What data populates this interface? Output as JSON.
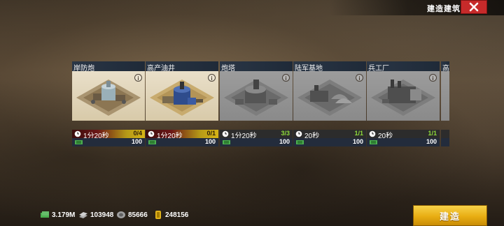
{
  "header": {
    "title": "建造建筑"
  },
  "buildings": [
    {
      "name": "岸防炮",
      "time": "1分20秒",
      "count": "0/4",
      "cost": "100",
      "state": "available"
    },
    {
      "name": "高产油井",
      "time": "1分20秒",
      "count": "0/1",
      "cost": "100",
      "state": "available"
    },
    {
      "name": "炮塔",
      "time": "1分20秒",
      "count": "3/3",
      "cost": "100",
      "state": "maxed"
    },
    {
      "name": "陆军基地",
      "time": "20秒",
      "count": "1/1",
      "cost": "100",
      "state": "maxed"
    },
    {
      "name": "兵工厂",
      "time": "20秒",
      "count": "1/1",
      "cost": "100",
      "state": "maxed"
    },
    {
      "name": "高",
      "time": "",
      "count": "",
      "cost": "",
      "state": "partial"
    }
  ],
  "resources": {
    "cash": "3.179M",
    "steel": "103948",
    "oil": "85666",
    "gold": "248156"
  },
  "actions": {
    "build_label": "建造"
  },
  "colors": {
    "build_button": "#e8ad12",
    "close_button": "#c72a2a",
    "header": "#1f2a38"
  }
}
